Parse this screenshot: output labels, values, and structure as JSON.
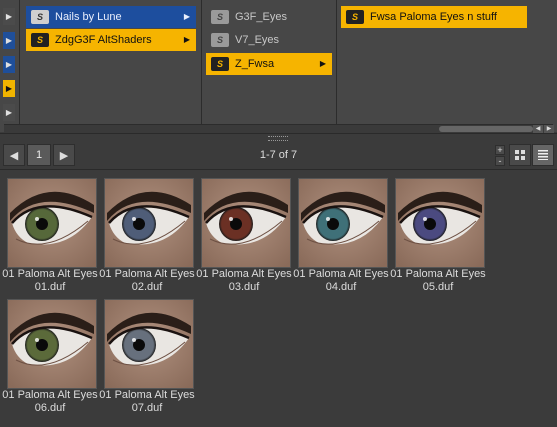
{
  "browser": {
    "col1": [
      {
        "label": "Nails by Lune",
        "state": "blue"
      },
      {
        "label": "ZdgG3F AltShaders",
        "state": "gold"
      }
    ],
    "col2": [
      {
        "label": "G3F_Eyes",
        "state": "dim"
      },
      {
        "label": "V7_Eyes",
        "state": "dim"
      },
      {
        "label": "Z_Fwsa",
        "state": "gold"
      }
    ],
    "col3": [
      {
        "label": "Fwsa Paloma Eyes n stuff",
        "state": "gold"
      }
    ],
    "folder_icon_glyph": "S"
  },
  "toolbar": {
    "page": "1",
    "count": "1-7 of 7",
    "size_up": "+",
    "size_down": "-"
  },
  "items": [
    {
      "line1": "01 Paloma Alt Eyes",
      "line2": "01.duf",
      "iris": "#56683a"
    },
    {
      "line1": "01 Paloma Alt Eyes",
      "line2": "02.duf",
      "iris": "#4f5d78"
    },
    {
      "line1": "01 Paloma Alt Eyes",
      "line2": "03.duf",
      "iris": "#6b3024"
    },
    {
      "line1": "01 Paloma Alt Eyes",
      "line2": "04.duf",
      "iris": "#3f7078"
    },
    {
      "line1": "01 Paloma Alt Eyes",
      "line2": "05.duf",
      "iris": "#4b4a80"
    },
    {
      "line1": "01 Paloma Alt Eyes",
      "line2": "06.duf",
      "iris": "#5b6a3a"
    },
    {
      "line1": "01 Paloma Alt Eyes",
      "line2": "07.duf",
      "iris": "#67707d"
    }
  ]
}
